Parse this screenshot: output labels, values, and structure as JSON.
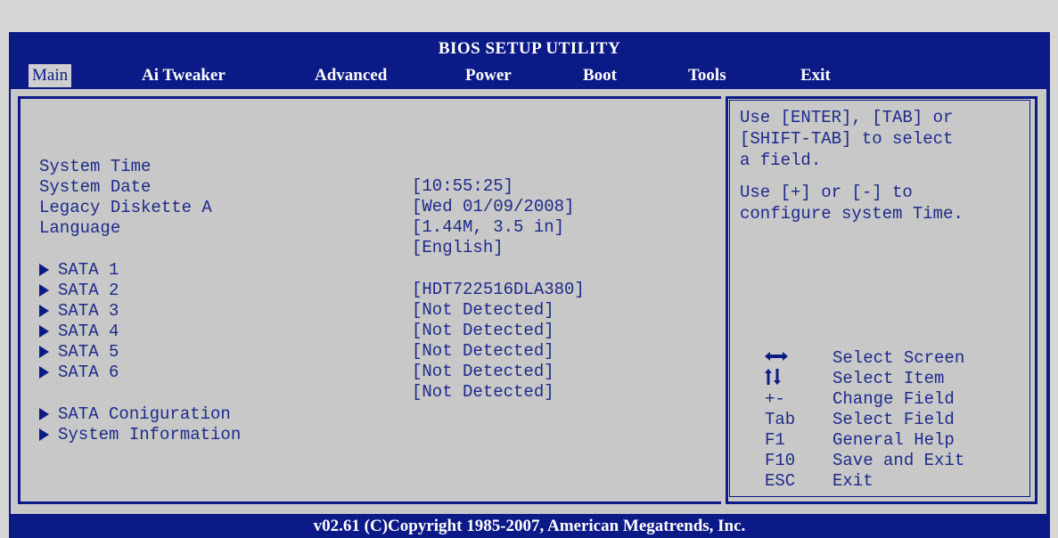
{
  "header": {
    "title": "BIOS SETUP UTILITY"
  },
  "menu": [
    {
      "label": "Main"
    },
    {
      "label": "Ai Tweaker"
    },
    {
      "label": "Advanced"
    },
    {
      "label": "Power"
    },
    {
      "label": "Boot"
    },
    {
      "label": "Tools"
    },
    {
      "label": "Exit"
    }
  ],
  "settings": [
    {
      "label": "System Time",
      "value": "[10:55:25]"
    },
    {
      "label": "System Date",
      "value": "[Wed 01/09/2008]"
    },
    {
      "label": "Legacy Diskette A",
      "value": "[1.44M, 3.5 in]"
    },
    {
      "label": "Language",
      "value": "[English]"
    }
  ],
  "sata": [
    {
      "label": "SATA 1",
      "value": "[HDT722516DLA380]"
    },
    {
      "label": "SATA 2",
      "value": "[Not Detected]"
    },
    {
      "label": "SATA 3",
      "value": "[Not Detected]"
    },
    {
      "label": "SATA 4",
      "value": "[Not Detected]"
    },
    {
      "label": "SATA 5",
      "value": "[Not Detected]"
    },
    {
      "label": "SATA 6",
      "value": "[Not Detected]"
    }
  ],
  "submenus": [
    {
      "label": "SATA Coniguration"
    },
    {
      "label": "System Information"
    }
  ],
  "help": {
    "line1": "Use [ENTER], [TAB] or",
    "line2": "[SHIFT-TAB] to select",
    "line3": "a field.",
    "line4": "Use [+] or [-] to",
    "line5": "configure system Time."
  },
  "keys": [
    {
      "key": "",
      "icon": "left-right-arrows-icon",
      "desc": "Select Screen"
    },
    {
      "key": "",
      "icon": "up-down-arrows-icon",
      "desc": "Select Item"
    },
    {
      "key": "+-",
      "desc": "Change Field"
    },
    {
      "key": "Tab",
      "desc": "Select Field"
    },
    {
      "key": "F1",
      "desc": "General Help"
    },
    {
      "key": "F10",
      "desc": "Save and Exit"
    },
    {
      "key": "ESC",
      "desc": "Exit"
    }
  ],
  "footer": "v02.61 (C)Copyright 1985-2007, American Megatrends, Inc."
}
